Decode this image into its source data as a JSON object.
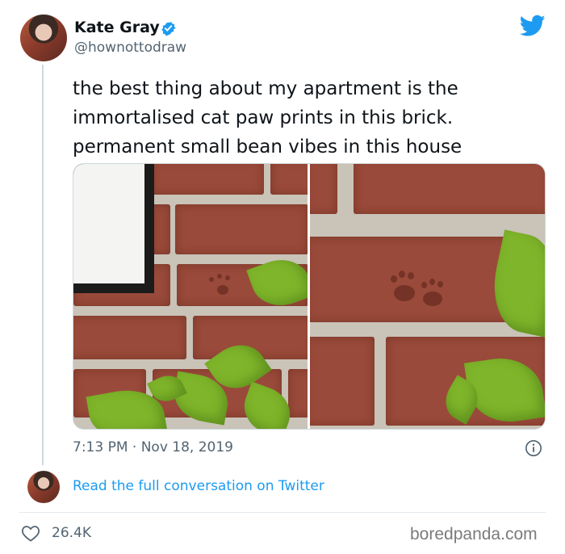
{
  "tweet": {
    "author_name": "Kate Gray",
    "author_handle": "@hownottodraw",
    "text": "the best thing about my apartment is the\nimmortalised cat paw prints in this brick.\npermanent small bean vibes in this house",
    "timestamp": "7:13 PM · Nov 18, 2019",
    "read_link": "Read the full conversation on Twitter",
    "like_count": "26.4K",
    "icons": {
      "platform": "twitter-bird-icon",
      "verified": "verified-badge-icon",
      "info": "info-icon",
      "like": "heart-icon"
    }
  },
  "watermark": "boredpanda.com",
  "colors": {
    "accent": "#1d9bf0",
    "text": "#0f1419",
    "secondary_text": "#536471"
  }
}
